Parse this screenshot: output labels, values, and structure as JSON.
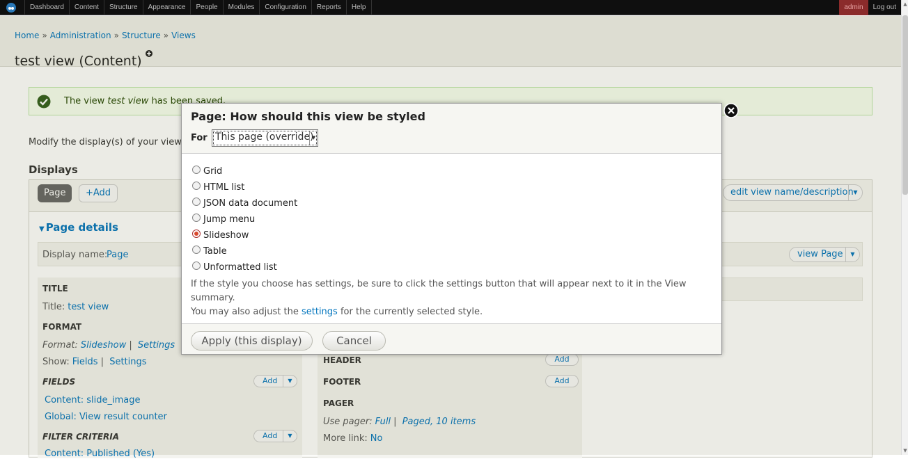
{
  "toolbar": {
    "menu": [
      "Dashboard",
      "Content",
      "Structure",
      "Appearance",
      "People",
      "Modules",
      "Configuration",
      "Reports",
      "Help"
    ],
    "user": "admin",
    "logout": "Log out"
  },
  "breadcrumb": [
    "Home",
    "Administration",
    "Structure",
    "Views"
  ],
  "breadcrumb_sep": "»",
  "page_title": "test view (Content)",
  "status": {
    "prefix": "The view ",
    "name": "test view",
    "suffix": " has been saved."
  },
  "intro": "Modify the display(s) of your view",
  "displays": {
    "heading": "Displays",
    "tab_page": "Page",
    "tab_add": "+Add",
    "edit_view": "edit view name/description",
    "page_details": "Page details",
    "display_name_label": "Display name:",
    "display_name_value": "Page",
    "view_page": "view Page"
  },
  "sections": {
    "title_h": "TITLE",
    "title_label": "Title:",
    "title_value": "test view",
    "format_h": "FORMAT",
    "format_label": "Format:",
    "format_value": "Slideshow",
    "format_settings": "Settings",
    "show_label": "Show:",
    "show_value": "Fields",
    "show_settings": "Settings",
    "fields_h": "FIELDS",
    "field_1": "Content: slide_image",
    "field_2": "Global: View result counter",
    "filter_h": "FILTER CRITERIA",
    "filter_1": "Content: Published (Yes)",
    "header_h": "HEADER",
    "footer_h": "FOOTER",
    "pager_h": "PAGER",
    "use_pager_label": "Use pager:",
    "use_pager_value": "Full",
    "use_pager_detail": "Paged, 10 items",
    "more_link_label": "More link:",
    "more_link_value": "No",
    "add": "Add"
  },
  "modal": {
    "title": "Page: How should this view be styled",
    "for_label": "For",
    "for_value": "This page (override)",
    "options": [
      "Grid",
      "HTML list",
      "JSON data document",
      "Jump menu",
      "Slideshow",
      "Table",
      "Unformatted list"
    ],
    "selected": "Slideshow",
    "help_1": "If the style you choose has settings, be sure to click the settings button that will appear next to it in the View summary.",
    "help_2_pre": "You may also adjust the ",
    "help_2_link": "settings",
    "help_2_post": " for the currently selected style.",
    "apply": "Apply (this display)",
    "cancel": "Cancel"
  },
  "icons": {
    "toolbar_home": "drupal-drop-icon",
    "status": "check-circle-icon",
    "shortcut": "add-shortcut-icon",
    "close": "close-icon"
  },
  "colors": {
    "link": "#0074bd",
    "toolbar_bg": "#0f0f0f",
    "user_bg": "#8b2b2b",
    "radio_checked": "#d9482d"
  }
}
